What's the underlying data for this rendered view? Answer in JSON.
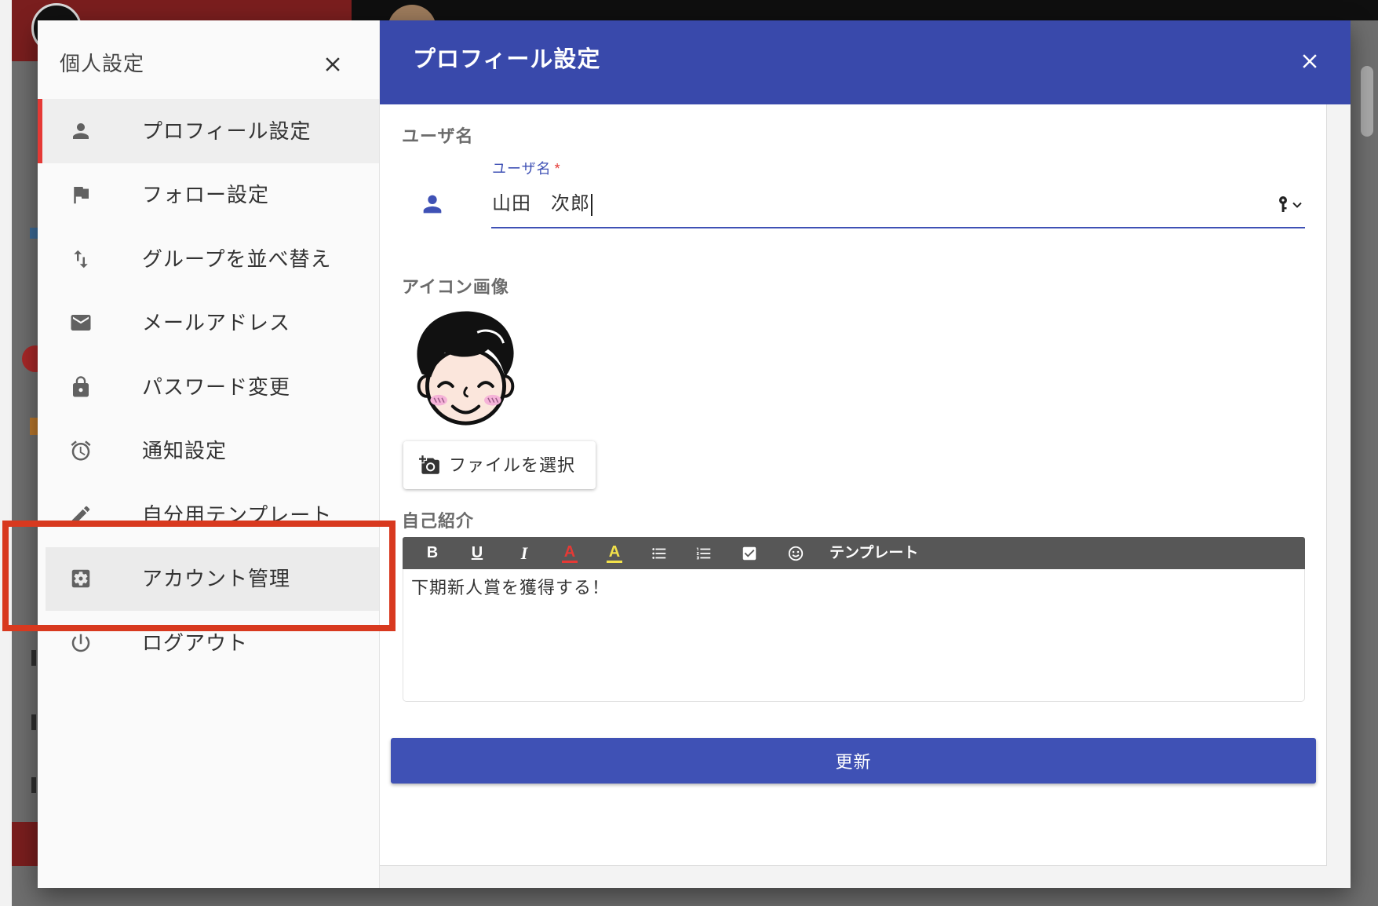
{
  "settings_menu": {
    "title": "個人設定",
    "close_icon": "close-icon",
    "items": [
      {
        "label": "プロフィール設定",
        "icon": "person-icon",
        "selected": true
      },
      {
        "label": "フォロー設定",
        "icon": "flag-icon"
      },
      {
        "label": "グループを並べ替え",
        "icon": "swap-vertical-icon"
      },
      {
        "label": "メールアドレス",
        "icon": "mail-icon"
      },
      {
        "label": "パスワード変更",
        "icon": "lock-icon"
      },
      {
        "label": "通知設定",
        "icon": "alarm-clock-icon"
      },
      {
        "label": "自分用テンプレート",
        "icon": "pencil-icon"
      },
      {
        "label": "アカウント管理",
        "icon": "account-settings-icon",
        "highlighted": true
      },
      {
        "label": "ログアウト",
        "icon": "power-icon"
      }
    ]
  },
  "profile_dialog": {
    "title": "プロフィール設定",
    "close_icon": "close-icon",
    "username": {
      "section_label": "ユーザ名",
      "field_label": "ユーザ名",
      "required_mark": "*",
      "value": "山田　次郎",
      "icon": "person-icon",
      "autofill_icon": "key-icon"
    },
    "icon_image": {
      "section_label": "アイコン画像",
      "choose_file_label": "ファイルを選択",
      "choose_file_icon": "add-photo-icon"
    },
    "bio": {
      "section_label": "自己紹介",
      "toolbar": [
        {
          "label": "B"
        },
        {
          "label": "U"
        },
        {
          "label": "I"
        },
        {
          "label": "A",
          "color": "#e53935"
        },
        {
          "label": "A",
          "color": "#f2e14a"
        },
        {
          "icon": "bulleted-list-icon"
        },
        {
          "icon": "numbered-list-icon"
        },
        {
          "icon": "checkbox-icon"
        },
        {
          "icon": "smiley-icon"
        }
      ],
      "template_label": "テンプレート",
      "text": "下期新人賞を獲得する！"
    },
    "update_button_label": "更新"
  },
  "colors": {
    "header_bg": "#3949ab",
    "accent": "#3f51b5",
    "selected_marker": "#e53935",
    "annotation_box": "#d8391f"
  }
}
